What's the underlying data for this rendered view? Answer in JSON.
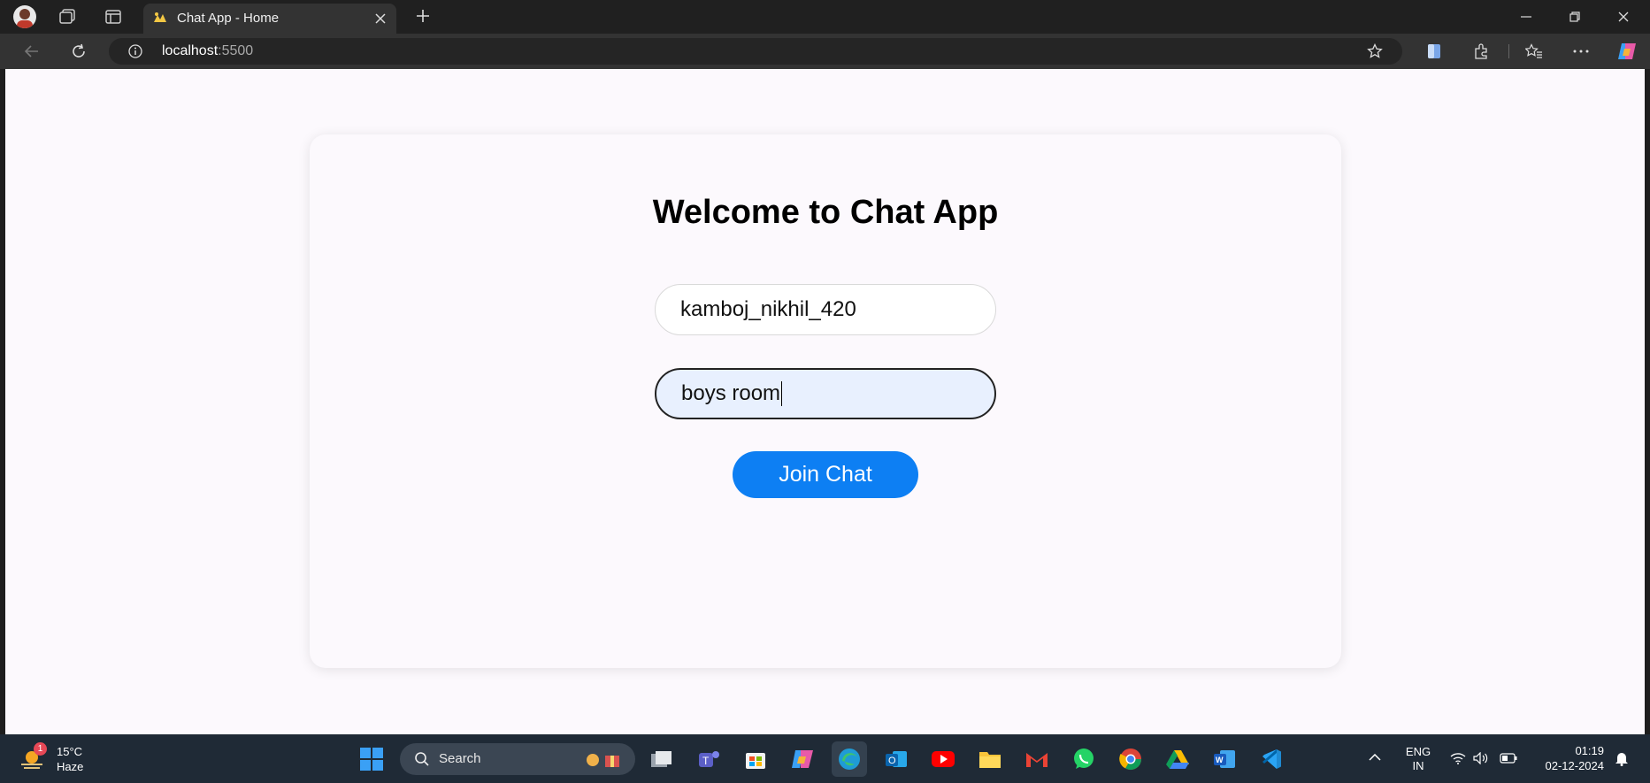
{
  "browser": {
    "tab_title": "Chat App - Home",
    "address_host": "localhost",
    "address_port": ":5500"
  },
  "page": {
    "heading": "Welcome to Chat App",
    "username_value": "kamboj_nikhil_420",
    "room_value": "boys room",
    "join_label": "Join Chat",
    "accent_color": "#0d7ff3"
  },
  "taskbar": {
    "weather_temp": "15°C",
    "weather_desc": "Haze",
    "weather_badge": "1",
    "search_label": "Search",
    "lang_top": "ENG",
    "lang_bottom": "IN",
    "time": "01:19",
    "date": "02-12-2024"
  }
}
